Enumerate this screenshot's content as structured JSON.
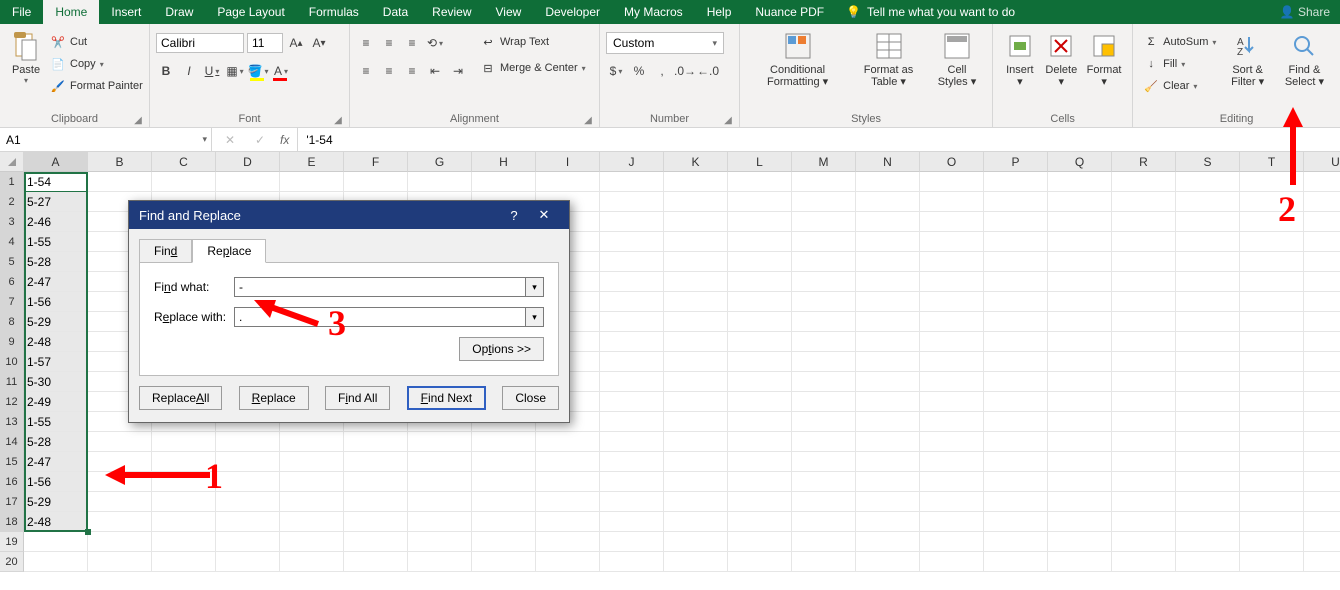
{
  "tabs": {
    "file": "File",
    "home": "Home",
    "insert": "Insert",
    "draw": "Draw",
    "pagelayout": "Page Layout",
    "formulas": "Formulas",
    "data": "Data",
    "review": "Review",
    "view": "View",
    "developer": "Developer",
    "mymacros": "My Macros",
    "help": "Help",
    "nuance": "Nuance PDF",
    "tellme": "Tell me what you want to do",
    "share": "Share"
  },
  "ribbon": {
    "clipboard": {
      "paste": "Paste",
      "cut": "Cut",
      "copy": "Copy",
      "formatpainter": "Format Painter",
      "label": "Clipboard"
    },
    "font": {
      "name": "Calibri",
      "size": "11",
      "label": "Font"
    },
    "alignment": {
      "wrap": "Wrap Text",
      "merge": "Merge & Center",
      "label": "Alignment"
    },
    "number": {
      "format": "Custom",
      "label": "Number"
    },
    "styles": {
      "cond": "Conditional Formatting",
      "table": "Format as Table",
      "cell": "Cell Styles",
      "label": "Styles"
    },
    "cells": {
      "insert": "Insert",
      "delete": "Delete",
      "format": "Format",
      "label": "Cells"
    },
    "editing": {
      "autosum": "AutoSum",
      "fill": "Fill",
      "clear": "Clear",
      "sort": "Sort & Filter",
      "find": "Find & Select",
      "label": "Editing"
    }
  },
  "namebox": "A1",
  "formula": "'1-54",
  "columns": [
    "A",
    "B",
    "C",
    "D",
    "E",
    "F",
    "G",
    "H",
    "I",
    "J",
    "K",
    "L",
    "M",
    "N",
    "O",
    "P",
    "Q",
    "R",
    "S",
    "T",
    "U"
  ],
  "cells": {
    "A": [
      "1-54",
      "5-27",
      "2-46",
      "1-55",
      "5-28",
      "2-47",
      "1-56",
      "5-29",
      "2-48",
      "1-57",
      "5-30",
      "2-49",
      "1-55",
      "5-28",
      "2-47",
      "1-56",
      "5-29",
      "2-48",
      "",
      ""
    ]
  },
  "selection": {
    "col": "A",
    "row_start": 1,
    "row_end": 18
  },
  "dialog": {
    "title": "Find and Replace",
    "tabs": {
      "find": "Find",
      "replace": "Replace"
    },
    "find_label": "Find what:",
    "replace_label": "Replace with:",
    "find_value": "-",
    "replace_value": ".",
    "options": "Options >>",
    "btn_replace_all": "Replace All",
    "btn_replace": "Replace",
    "btn_find_all": "Find All",
    "btn_find_next": "Find Next",
    "btn_close": "Close"
  },
  "annotations": {
    "one": "1",
    "two": "2",
    "three": "3"
  }
}
